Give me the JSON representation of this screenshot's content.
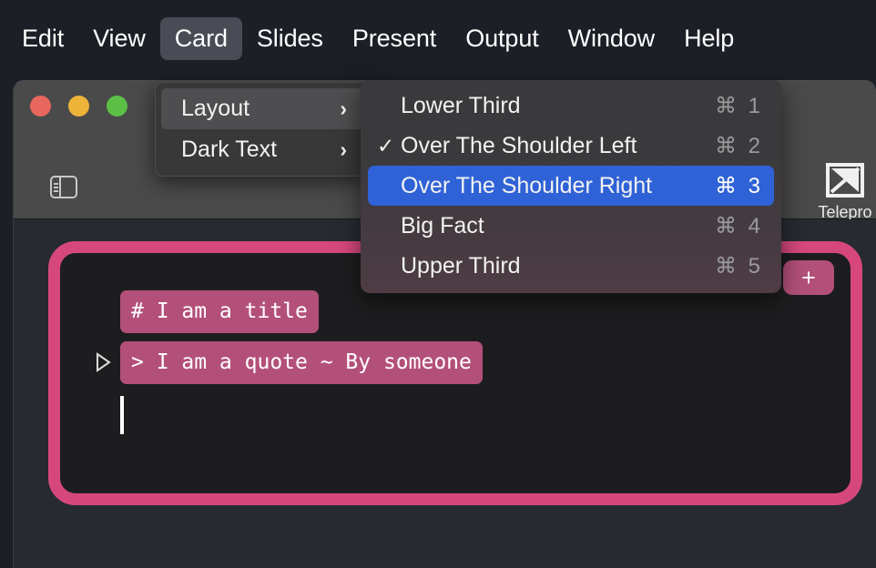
{
  "menubar": {
    "items": [
      {
        "label": "Edit",
        "active": false
      },
      {
        "label": "View",
        "active": false
      },
      {
        "label": "Card",
        "active": true
      },
      {
        "label": "Slides",
        "active": false
      },
      {
        "label": "Present",
        "active": false
      },
      {
        "label": "Output",
        "active": false
      },
      {
        "label": "Window",
        "active": false
      },
      {
        "label": "Help",
        "active": false
      }
    ]
  },
  "window": {
    "traffic_lights": [
      {
        "name": "close",
        "color": "#e8675c"
      },
      {
        "name": "minimize",
        "color": "#eeb43a"
      },
      {
        "name": "zoom",
        "color": "#5cc047"
      }
    ],
    "toolbar": {
      "sidebar_toggle_icon": "sidebar-toggle-icon",
      "teleprompter_label": "Telepro",
      "teleprompter_icon": "teleprompter-icon"
    }
  },
  "card_menu": {
    "items": [
      {
        "label": "Layout",
        "submenu_indicator": "›",
        "hovered": true
      },
      {
        "label": "Dark Text",
        "submenu_indicator": "›",
        "hovered": false
      }
    ]
  },
  "layout_submenu": {
    "items": [
      {
        "label": "Lower Third",
        "shortcut": "⌘ 1",
        "checked": false,
        "selected": false
      },
      {
        "label": "Over The Shoulder Left",
        "shortcut": "⌘ 2",
        "checked": true,
        "selected": false
      },
      {
        "label": "Over The Shoulder Right",
        "shortcut": "⌘ 3",
        "checked": false,
        "selected": true
      },
      {
        "label": "Big Fact",
        "shortcut": "⌘ 4",
        "checked": false,
        "selected": false
      },
      {
        "label": "Upper Third",
        "shortcut": "⌘ 5",
        "checked": false,
        "selected": false
      }
    ],
    "checkmark_glyph": "✓"
  },
  "card_editor": {
    "add_button_label": "+",
    "lines": [
      {
        "text": "# I am a title",
        "has_play_icon": false
      },
      {
        "text": "> I am a quote ~ By someone",
        "has_play_icon": true
      }
    ],
    "caret_visible": true
  },
  "colors": {
    "menubar_bg": "#1d1f27",
    "titlebar_bg": "#4a4a4a",
    "canvas_bg": "#272b31",
    "card_bg": "#1d1d1f",
    "card_border_pink": "#d6487c",
    "text_highlight_mauve": "#b35079",
    "menu_bg": "#383838",
    "submenu_bg": "#3a3a3c",
    "selection_blue": "#2f62d6",
    "shortcut_gray": "#9a9a9c"
  }
}
